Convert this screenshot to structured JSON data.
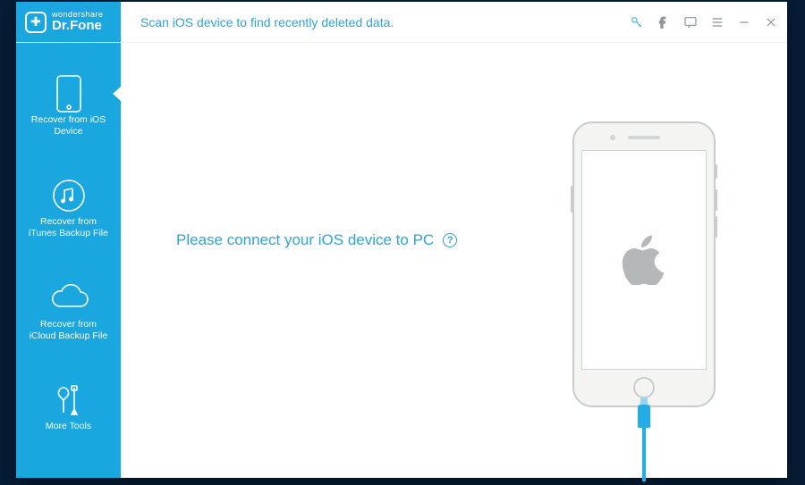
{
  "brand": {
    "top": "wondershare",
    "bottom": "Dr.Fone"
  },
  "header": {
    "instruction": "Scan iOS device to find recently deleted data."
  },
  "sidebar": {
    "items": [
      {
        "label": "Recover from iOS\nDevice",
        "active": true
      },
      {
        "label": "Recover from\niTunes Backup File",
        "active": false
      },
      {
        "label": "Recover from\niCloud Backup File",
        "active": false
      },
      {
        "label": "More Tools",
        "active": false
      }
    ]
  },
  "content": {
    "prompt": "Please connect your iOS device to PC",
    "help_symbol": "?"
  },
  "colors": {
    "accent": "#1aa7df",
    "text_accent": "#2ea4d8",
    "cable": "#22ade6",
    "phone_frame": "#c8cccd"
  }
}
